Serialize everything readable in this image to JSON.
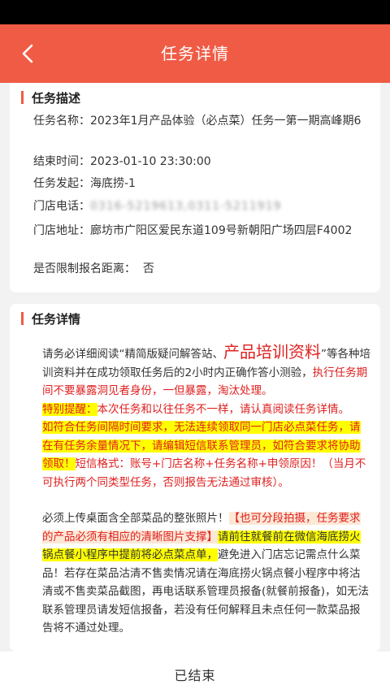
{
  "header": {
    "title": "任务详情"
  },
  "task_desc": {
    "section_title": "任务描述",
    "name_label": "任务名称：",
    "name_value": "2023年1月产品体验（必点菜）任务一第一期高峰期6",
    "end_label": "结束时间：",
    "end_value": "2023-01-10 23:30:00",
    "initiator_label": "任务发起：",
    "initiator_value": "海底捞-1",
    "phone_label": "门店电话：",
    "phone_value": "0316-5219613,0311-5211919",
    "address_label": "门店地址：",
    "address_value": "廊坊市广阳区爱民东道109号新朝阳广场四层F4002",
    "distance_label": "是否限制报名距离：",
    "distance_value": "否"
  },
  "task_detail": {
    "section_title": "任务详情",
    "p1_a": "请务必详细阅读“精简版疑问解答站、",
    "p1_big": "产品培训资料",
    "p1_b": "”等各种培训资料并在成功领取任务后的2小时内正确作答小测验，",
    "p1_red": "执行任务期间不要暴露洞见者身份，一但暴露，淘汰处理。",
    "p2_hl": "特别提醒：",
    "p2_red": "本次任务和以往任务不一样，请认真阅读任务详情。",
    "p3_hl": "如符合任务间隔时间要求，无法连续领取同一门店必点菜任务，请在有任务余量情况下，请编辑短信联系管理员，如符合要求将协助领取！",
    "p3_red": "短信格式：账号+门店名称+任务名称+申领原因！（当月不可执行两个同类型任务，否则报告无法通过审核）。",
    "p4_a": "必须上传桌面含全部菜品的整张照片！",
    "p4_pink": "【也可分段拍摄，任务要求的产品必须有相应的清晰图片支撑】",
    "p4_hl": "请前往就餐前在微信海底捞火锅点餐小程序中提前将必点菜点单，",
    "p4_b": "避免进入门店忘记需点什么菜品！若存在菜品沽清不售卖情况请在海底捞火锅点餐小程序中将沽清或不售卖菜品截图，再电话联系管理员报备(就餐前报备)，如无法联系管理员请发短信报备，若没有任何解释且未点任何一款菜品报告将不通过处理。"
  },
  "footer": {
    "status": "已结束"
  },
  "colors": {
    "accent": "#ef5b45",
    "warning": "#e02020",
    "highlight": "#ffff00"
  }
}
